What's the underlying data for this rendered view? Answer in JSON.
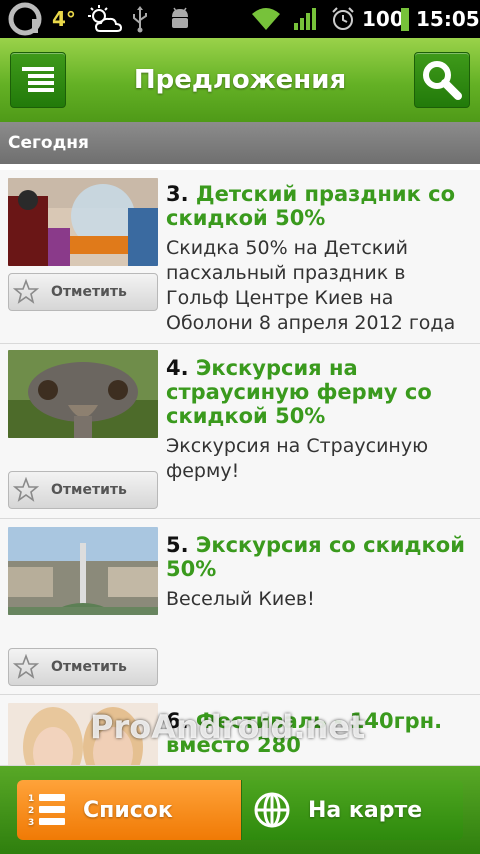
{
  "status_bar": {
    "temperature": "4°",
    "battery": "100",
    "time": "15:05"
  },
  "action_bar": {
    "title": "Предложения"
  },
  "section": {
    "header": "Сегодня"
  },
  "deals": [
    {
      "number": "3.",
      "title": "Детский праздник со скидкой 50%",
      "description": "Скидка 50% на Детский пасхальный праздник в Гольф Центре Киев на Оболони 8 апреля 2012 года",
      "mark_label": "Отметить"
    },
    {
      "number": "4.",
      "title": "Экскурсия на страусиную ферму со скидкой 50%",
      "description": "Экскурсия на Страусиную ферму!",
      "mark_label": "Отметить"
    },
    {
      "number": "5.",
      "title": "Экскурсия со скидкой 50%",
      "description": "Веселый Киев!",
      "mark_label": "Отметить"
    },
    {
      "number": "6.",
      "title": "Фестиваль - 140грн. вместо 280"
    }
  ],
  "watermark": "ProAndroid.net",
  "bottom_bar": {
    "list_label": "Список",
    "map_label": "На карте"
  }
}
